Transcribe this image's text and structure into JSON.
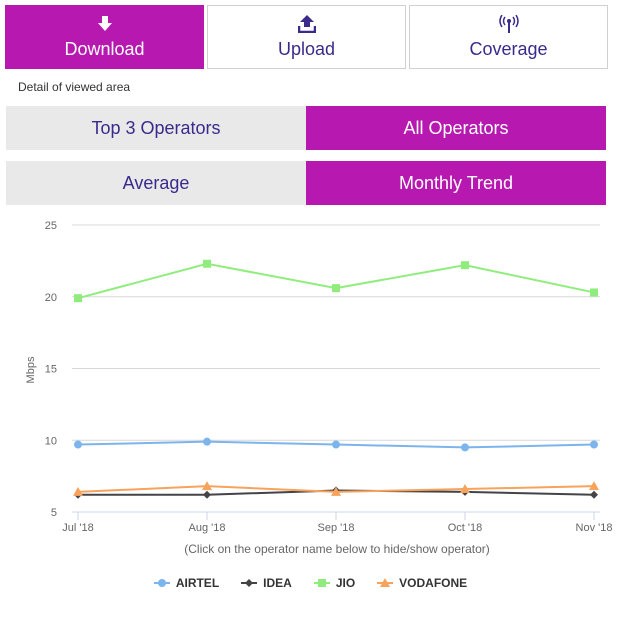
{
  "tabs": [
    {
      "label": "Download",
      "icon": "download-arrow-icon",
      "active": true
    },
    {
      "label": "Upload",
      "icon": "upload-icon",
      "active": false
    },
    {
      "label": "Coverage",
      "icon": "signal-tower-icon",
      "active": false
    }
  ],
  "subtitle": "Detail of viewed area",
  "operator_toggle": [
    {
      "label": "Top 3 Operators",
      "active": false
    },
    {
      "label": "All Operators",
      "active": true
    }
  ],
  "view_toggle": [
    {
      "label": "Average",
      "active": false
    },
    {
      "label": "Monthly Trend",
      "active": true
    }
  ],
  "colors": {
    "accent": "#b719b0",
    "text": "#3b2a8c"
  },
  "chart_data": {
    "type": "line",
    "title": "",
    "xlabel": "",
    "ylabel": "Mbps",
    "ylim": [
      5,
      25
    ],
    "yticks": [
      5,
      10,
      15,
      20,
      25
    ],
    "grid": true,
    "categories": [
      "Jul '18",
      "Aug '18",
      "Sep '18",
      "Oct '18",
      "Nov '18"
    ],
    "note": "(Click on the operator name below to hide/show operator)",
    "legend_position": "bottom",
    "series": [
      {
        "name": "AIRTEL",
        "color": "#7cb5ec",
        "marker": "circle",
        "values": [
          9.7,
          9.9,
          9.7,
          9.5,
          9.7
        ]
      },
      {
        "name": "IDEA",
        "color": "#434348",
        "marker": "diamond",
        "values": [
          6.2,
          6.2,
          6.5,
          6.4,
          6.2
        ]
      },
      {
        "name": "JIO",
        "color": "#90ed7d",
        "marker": "square",
        "values": [
          19.9,
          22.3,
          20.6,
          22.2,
          20.3
        ]
      },
      {
        "name": "VODAFONE",
        "color": "#f7a35c",
        "marker": "triangle",
        "values": [
          6.4,
          6.8,
          6.4,
          6.6,
          6.8
        ]
      }
    ]
  }
}
